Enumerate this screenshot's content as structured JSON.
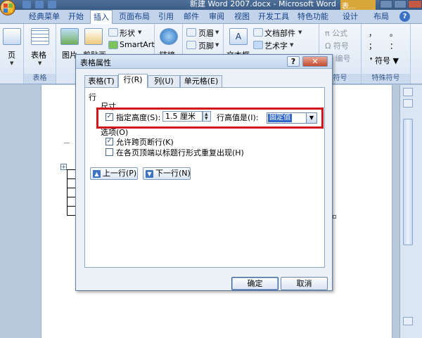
{
  "window": {
    "title": "新建 Word 2007.docx - Microsoft Word",
    "context_tool_title": "表..."
  },
  "ribbon_tabs": [
    {
      "label": "经典菜单",
      "active": false
    },
    {
      "label": "开始",
      "active": false
    },
    {
      "label": "插入",
      "active": true
    },
    {
      "label": "页面布局",
      "active": false
    },
    {
      "label": "引用",
      "active": false
    },
    {
      "label": "邮件",
      "active": false
    },
    {
      "label": "审阅",
      "active": false
    },
    {
      "label": "视图",
      "active": false
    },
    {
      "label": "开发工具",
      "active": false
    },
    {
      "label": "特色功能",
      "active": false
    },
    {
      "label": "设计",
      "active": false
    },
    {
      "label": "布局",
      "active": false
    }
  ],
  "ribbon": {
    "pages_label": "页",
    "table_label": "表格",
    "table_group_label": "表格",
    "picture_label": "图片",
    "clipart_label": "剪贴画",
    "shapes_label": "形状",
    "smartart_label": "SmartArt",
    "links_label": "链接",
    "header_label": "页眉",
    "footer_label": "页脚",
    "textbox_label": "文本框",
    "quickparts_label": "文档部件",
    "wordart_label": "艺术字",
    "equation_label": "公式",
    "symbol_small_label": "符号",
    "numbering_label": "编号",
    "symbols_group_label": "符号",
    "symbol_label": "符号",
    "special_symbols_group_label": "特殊符号",
    "special_chars": [
      "，",
      "。",
      "、",
      "；",
      "：",
      "？"
    ]
  },
  "dialog": {
    "title": "表格属性",
    "help_glyph": "?",
    "close_glyph": "✕",
    "tabs": [
      {
        "label": "表格(T)",
        "active": false
      },
      {
        "label": "行(R)",
        "active": true
      },
      {
        "label": "列(U)",
        "active": false
      },
      {
        "label": "单元格(E)",
        "active": false
      }
    ],
    "row_section_label": "行",
    "size_label": "尺寸",
    "specify_height_label": "指定高度(S):",
    "specify_height_checked": true,
    "height_value": "1.5 厘米",
    "height_type_label": "行高值是(I):",
    "height_type_value": "固定值",
    "options_label": "选项(O)",
    "allow_break_label": "允许跨页断行(K)",
    "allow_break_checked": true,
    "repeat_header_label": "在各页顶端以标题行形式重复出现(H)",
    "repeat_header_checked": false,
    "prev_row_label": "上一行(P)",
    "next_row_label": "下一行(N)",
    "ok_label": "确定",
    "cancel_label": "取消",
    "check_glyph": "✓",
    "arrow_up_glyph": "▲",
    "arrow_down_glyph": "▼"
  }
}
